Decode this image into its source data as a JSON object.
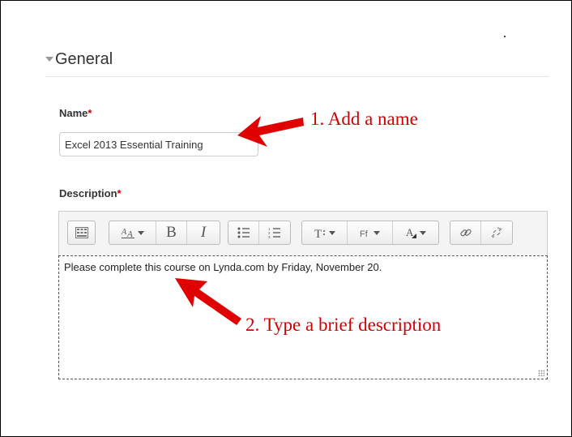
{
  "section": {
    "title": "General"
  },
  "name_field": {
    "label": "Name",
    "required_mark": "*",
    "value": "Excel 2013 Essential Training"
  },
  "description_field": {
    "label": "Description",
    "required_mark": "*",
    "text": "Please complete this course on Lynda.com by Friday, November 20."
  },
  "toolbar": {
    "bold": "B",
    "italic": "I",
    "buttons": [
      "toolbar-toggle-icon",
      "font-size-icon",
      "bold-icon",
      "italic-icon",
      "bullet-list-icon",
      "numbered-list-icon",
      "text-format-icon",
      "font-family-icon",
      "font-color-icon",
      "link-icon",
      "unlink-icon"
    ]
  },
  "annotations": {
    "step1": "1. Add a name",
    "step2": "2. Type a brief description",
    "color": "#d10000"
  }
}
